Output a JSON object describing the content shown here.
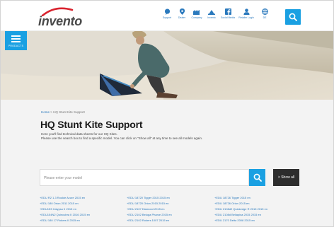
{
  "header": {
    "logo_text": "invento",
    "nav": [
      {
        "label": "Support",
        "icon": "chat-icon"
      },
      {
        "label": "Dealer",
        "icon": "location-pin-icon"
      },
      {
        "label": "Company",
        "icon": "factory-icon"
      },
      {
        "label": "Invento",
        "icon": "cloud-icon"
      },
      {
        "label": "Social Media",
        "icon": "facebook-icon"
      },
      {
        "label": "Retailer Login",
        "icon": "user-icon"
      },
      {
        "label": "DE",
        "icon": "globe-icon"
      }
    ],
    "search_icon": "search-icon"
  },
  "sidebar": {
    "products_label": "PRODUCTS"
  },
  "breadcrumb": {
    "home": "Home",
    "separator": ">",
    "current": "HQ Stunt Kite Support"
  },
  "page": {
    "title": "HQ Stunt Kite Support",
    "intro_line1": "Here you'll find technical data sheets for our HQ Kites.",
    "intro_line2": "Please use the search box to find a specific model. You can click on \"Show all\" at any time to see all models again."
  },
  "search": {
    "placeholder": "Please enter your model",
    "value": "",
    "show_all_label": "> Show all"
  },
  "models": [
    [
      "+EDU R2 1.3 Rookie Azure 2015 en",
      "+EDU 180 Orion 2011 2015 en",
      "+EDU153 Calypso II 2015 en",
      "+EDU154N2 Quincubra II 2016 2015 en",
      "+EDU 180 17 Rokers II 2015 en"
    ],
    [
      "+EDU 18720 Tigger 2015 2015 en",
      "+EDU 18720 Orion 2015 2015 en",
      "+EDU 2107 Diamond 2015 en",
      "+EDU 2102 Beluga Pharce 2015 en",
      "+EDU 2102 Rokers 1007 2015 en"
    ],
    [
      "+EDU 18726 Tigger 2015 en",
      "+EDU 18726 Orion 2015 en",
      "+EDU 2108d2 Quickedge R 2015 2015 en",
      "+EDU 2108d Bellapisa 2015 2015 en",
      "+EDU 2170 Delta 2008 2015 en"
    ]
  ],
  "colors": {
    "accent": "#1aa0e2",
    "link": "#2a79bd",
    "brand_red": "#d9232e",
    "dark_button": "#2d2d2d"
  }
}
